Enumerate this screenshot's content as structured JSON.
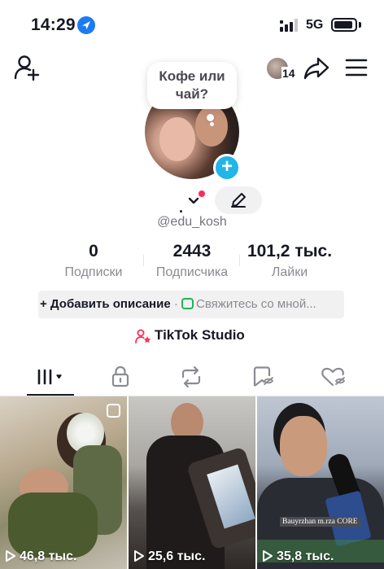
{
  "status_bar": {
    "time": "14:29",
    "network": "5G"
  },
  "nav": {
    "visitor_count": "14"
  },
  "profile": {
    "note": "Кофе или чай?",
    "name_dot": ".",
    "username": "@edu_kosh"
  },
  "stats": [
    {
      "value": "0",
      "label": "Подписки"
    },
    {
      "value": "2443",
      "label": "Подписчика"
    },
    {
      "value": "101,2 тыс.",
      "label": "Лайки"
    }
  ],
  "bio": {
    "add_description": "+ Добавить описание",
    "separator": "·",
    "contact": "Свяжитесь со мной..."
  },
  "studio": {
    "label": "TikTok Studio"
  },
  "tabs": [
    "videos-grid-icon",
    "lock-icon",
    "repost-icon",
    "saved-icon",
    "liked-icon"
  ],
  "videos": [
    {
      "views": "46,8 тыс."
    },
    {
      "views": "25,6 тыс."
    },
    {
      "views": "35,8 тыс.",
      "caption": "Bauyrzhan m.rza CORE"
    }
  ],
  "colors": {
    "accent_red": "#fe2c55",
    "plus_blue": "#21b5e8",
    "location_blue": "#1c7cf4",
    "contact_green": "#20b35a",
    "text_primary": "#161823",
    "text_secondary": "#8a8b91"
  }
}
